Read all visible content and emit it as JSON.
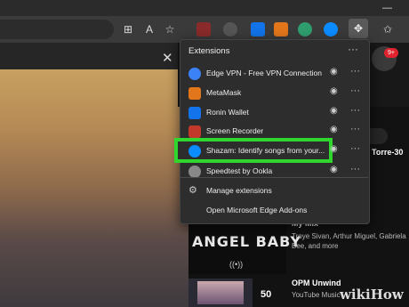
{
  "extensions_panel": {
    "title": "Extensions",
    "more_icon": "more-horizontal-icon",
    "items": [
      {
        "label": "Edge VPN - Free VPN Connection",
        "icon": "edge-vpn-icon",
        "color": "#3b82f6"
      },
      {
        "label": "MetaMask",
        "icon": "metamask-fox-icon",
        "color": "#e2761b"
      },
      {
        "label": "Ronin Wallet",
        "icon": "ronin-shield-icon",
        "color": "#1273ea"
      },
      {
        "label": "Screen Recorder",
        "icon": "screen-recorder-icon",
        "color": "#c0392b"
      },
      {
        "label": "Shazam: Identify songs from your...",
        "icon": "shazam-icon",
        "color": "#0b8cff"
      },
      {
        "label": "Speedtest by Ookla",
        "icon": "speedtest-icon",
        "color": "#888888"
      }
    ],
    "manage_label": "Manage extensions",
    "addons_label": "Open Microsoft Edge Add-ons"
  },
  "highlight_color": "#2ed62e",
  "hero": {
    "close_icon": "close-icon"
  },
  "notification_badge": "9+",
  "playlist": [
    {
      "title": "Torre-30",
      "subtitle": ""
    },
    {
      "title": "My Mix",
      "subtitle": "Troye Sivan, Arthur Miguel, Gabriela Bee, and more",
      "thumb_text": "ANGEL BABY",
      "thumb_icon": "((•))"
    },
    {
      "title": "OPM Unwind",
      "subtitle": "YouTube Music",
      "number": "50"
    }
  ],
  "watermark": "wikiHow"
}
